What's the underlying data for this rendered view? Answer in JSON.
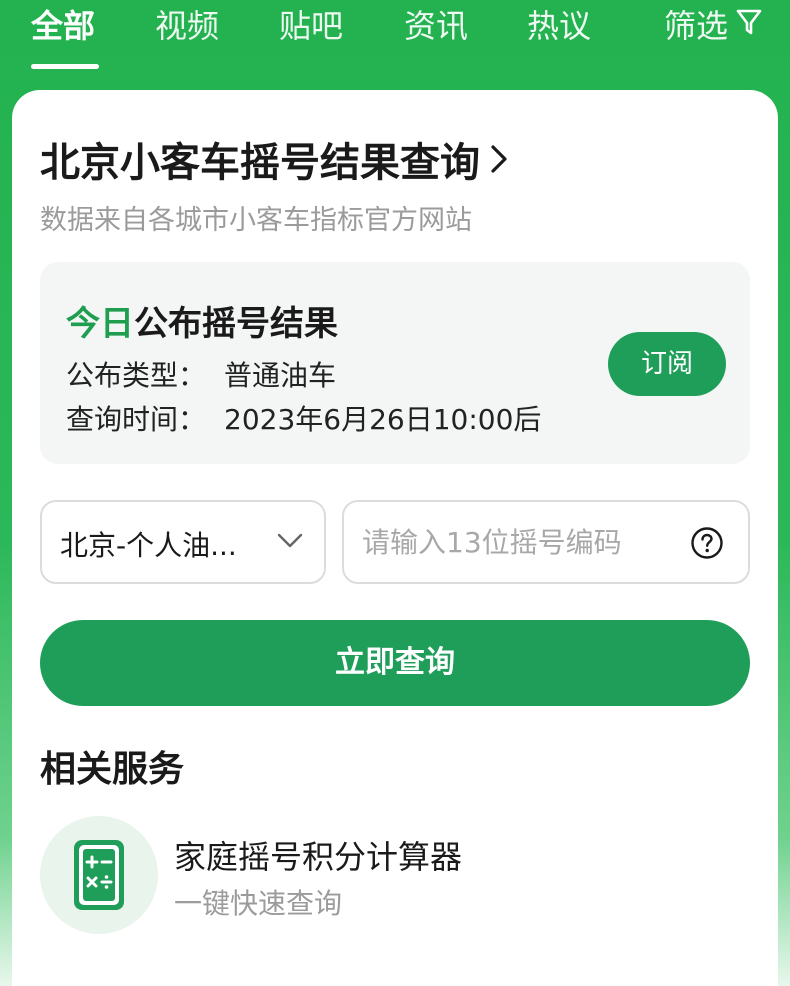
{
  "tabs": [
    {
      "label": "全部",
      "active": true
    },
    {
      "label": "视频"
    },
    {
      "label": "贴吧"
    },
    {
      "label": "资讯"
    },
    {
      "label": "热议"
    },
    {
      "label": "筛选"
    }
  ],
  "card": {
    "title": "北京小客车摇号结果查询",
    "subtitle": "数据来自各城市小客车指标官方网站",
    "result": {
      "heading_green": "今日",
      "heading_rest": "公布摇号结果",
      "line1_label": "公布类型：",
      "line1_value": "普通油车",
      "line2_label": "查询时间：",
      "line2_value": "2023年6月26日10:00后",
      "subscribe_label": "订阅"
    },
    "select_value": "北京-个人油...",
    "input_placeholder": "请输入13位摇号编码",
    "query_label": "立即查询",
    "related": {
      "title": "相关服务",
      "service_title": "家庭摇号积分计算器",
      "service_sub": "一键快速查询"
    }
  },
  "colors": {
    "accent": "#1f9e5a",
    "header_green": "#23b24f"
  },
  "icons": {
    "filter": "filter-icon",
    "chevron_right": "chevron-right-icon",
    "chevron_down": "chevron-down-icon",
    "help": "help-circle-icon",
    "calculator": "calculator-icon"
  }
}
